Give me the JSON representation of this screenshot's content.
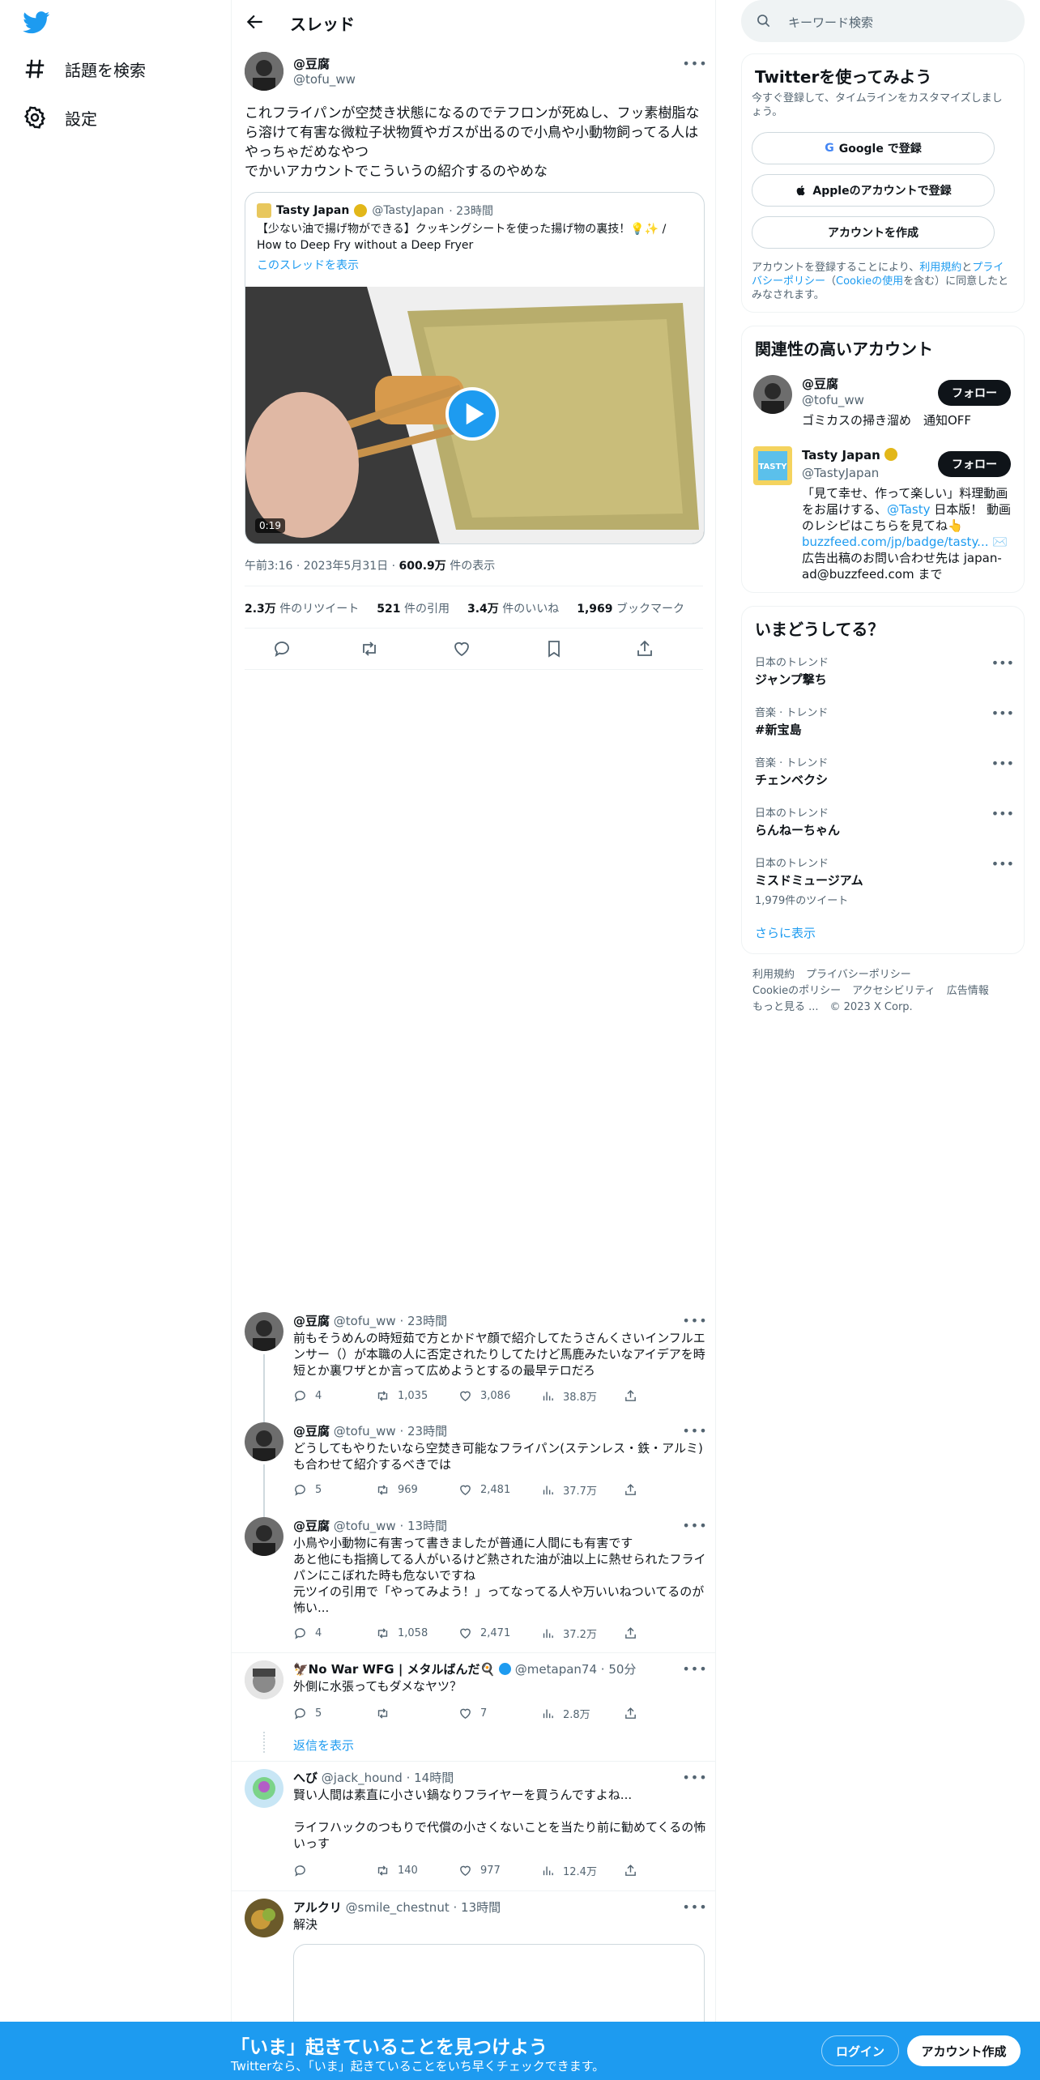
{
  "nav": {
    "explore_label": "話題を検索",
    "settings_label": "設定"
  },
  "header": {
    "title": "スレッド"
  },
  "main_tweet": {
    "name": "@豆腐",
    "handle": "@tofu_ww",
    "text": "これフライパンが空焚き状態になるのでテフロンが死ぬし、フッ素樹脂なら溶けて有害な微粒子状物質やガスが出るので小鳥や小動物飼ってる人はやっちゃだめなやつ\nでかいアカウントでこういうの紹介するのやめな",
    "quote": {
      "name": "Tasty Japan",
      "handle": "@TastyJapan",
      "time": "· 23時間",
      "text": "【少ない油で揚げ物ができる】クッキングシートを使った揚げ物の裏技！💡✨ / How to Deep Fry without a Deep Fryer",
      "show_thread": "このスレッドを表示",
      "video_time": "0:19"
    },
    "timestamp": "午前3:16 · 2023年5月31日 · ",
    "views_value": "600.9万",
    "views_label": " 件の表示",
    "stats": {
      "retweets_value": "2.3万",
      "retweets_label": "件のリツイート",
      "quotes_value": "521",
      "quotes_label": "件の引用",
      "likes_value": "3.4万",
      "likes_label": "件のいいね",
      "bookmarks_value": "1,969",
      "bookmarks_label": "ブックマーク"
    }
  },
  "replies": [
    {
      "name": "@豆腐",
      "handle": "@tofu_ww",
      "time": "· 23時間",
      "text": "前もそうめんの時短茹で方とかドヤ顔で紹介してたうさんくさいインフルエンサー（）が本職の人に否定されたりしてたけど馬鹿みたいなアイデアを時短とか裏ワザとか言って広めようとするの最早テロだろ",
      "replies": "4",
      "retweets": "1,035",
      "likes": "3,086",
      "views": "38.8万"
    },
    {
      "name": "@豆腐",
      "handle": "@tofu_ww",
      "time": "· 23時間",
      "text": "どうしてもやりたいなら空焚き可能なフライパン(ステンレス・鉄・アルミ)も合わせて紹介するべきでは",
      "replies": "5",
      "retweets": "969",
      "likes": "2,481",
      "views": "37.7万"
    },
    {
      "name": "@豆腐",
      "handle": "@tofu_ww",
      "time": "· 13時間",
      "text": "小鳥や小動物に有害って書きましたが普通に人間にも有害です\nあと他にも指摘してる人がいるけど熱された油が油以上に熱せられたフライパンにこぼれた時も危ないですね\n元ツイの引用で「やってみよう！」ってなってる人や万いいねついてるのが怖い...",
      "replies": "4",
      "retweets": "1,058",
      "likes": "2,471",
      "views": "37.2万"
    },
    {
      "name": "🦅No War WFG | メタルばんだ🍳",
      "handle": "@metapan74",
      "time": "· 50分",
      "text": "外側に水張ってもダメなヤツ？",
      "replies": "5",
      "retweets": "",
      "likes": "7",
      "views": "2.8万",
      "show_replies": "返信を表示"
    },
    {
      "name": "へび",
      "handle": "@jack_hound",
      "time": "· 14時間",
      "text": "賢い人間は素直に小さい鍋なりフライヤーを買うんですよね...\n\nライフハックのつもりで代償の小さくないことを当たり前に勧めてくるの怖いっす",
      "replies": "",
      "retweets": "140",
      "likes": "977",
      "views": "12.4万"
    },
    {
      "name": "アルクリ",
      "handle": "@smile_chestnut",
      "time": "· 13時間",
      "text": "解決"
    }
  ],
  "sidebar": {
    "search_placeholder": "キーワード検索",
    "signup": {
      "title": "Twitterを使ってみよう",
      "subtitle": "今すぐ登録して、タイムラインをカスタマイズしましょう。",
      "google_label": "Google で登録",
      "apple_label": "Appleのアカウントで登録",
      "create_label": "アカウントを作成",
      "terms_pre": "アカウントを登録することにより、",
      "terms_link": "利用規約",
      "terms_mid": "と",
      "privacy_link": "プライバシーポリシー",
      "terms_paren_open": "（",
      "cookie_link": "Cookieの使用",
      "terms_post": "を含む）に同意したとみなされます。"
    },
    "relevant": {
      "title": "関連性の高いアカウント",
      "follow_label": "フォロー",
      "accounts": [
        {
          "name": "@豆腐",
          "handle": "@tofu_ww",
          "bio": "ゴミカスの掃き溜め　通知OFF"
        },
        {
          "name": "Tasty Japan",
          "handle": "@TastyJapan",
          "bio_pre": "「見て幸せ、作って楽しい」料理動画をお届けする、",
          "bio_mention": "@Tasty",
          "bio_mid": " 日本版！ 動画のレシピはこちらを見てね👆",
          "bio_link": "buzzfeed.com/jp/badge/tasty...",
          "bio_post": " ✉️広告出稿のお問い合わせ先は japan-ad@buzzfeed.com まで"
        }
      ]
    },
    "trends": {
      "title": "いまどうしてる？",
      "items": [
        {
          "category": "日本のトレンド",
          "name": "ジャンプ撃ち",
          "count": ""
        },
        {
          "category": "音楽 · トレンド",
          "name": "#新宝島",
          "count": ""
        },
        {
          "category": "音楽 · トレンド",
          "name": "チェンベクシ",
          "count": ""
        },
        {
          "category": "日本のトレンド",
          "name": "らんねーちゃん",
          "count": ""
        },
        {
          "category": "日本のトレンド",
          "name": "ミスドミュージアム",
          "count": "1,979件のツイート"
        }
      ],
      "show_more": "さらに表示"
    },
    "footer": {
      "terms": "利用規約",
      "privacy": "プライバシーポリシー",
      "cookie": "Cookieのポリシー",
      "accessibility": "アクセシビリティ",
      "ads": "広告情報",
      "more": "もっと見る ...",
      "copyright": "© 2023 X Corp."
    }
  },
  "banner": {
    "title": "「いま」起きていることを見つけよう",
    "subtitle": "Twitterなら、「いま」起きていることをいち早くチェックできます。",
    "login_label": "ログイン",
    "signup_label": "アカウント作成"
  },
  "colors": {
    "accent": "#1d9bf0",
    "text": "#0f1419",
    "muted": "#536471",
    "border": "#eff3f4"
  }
}
